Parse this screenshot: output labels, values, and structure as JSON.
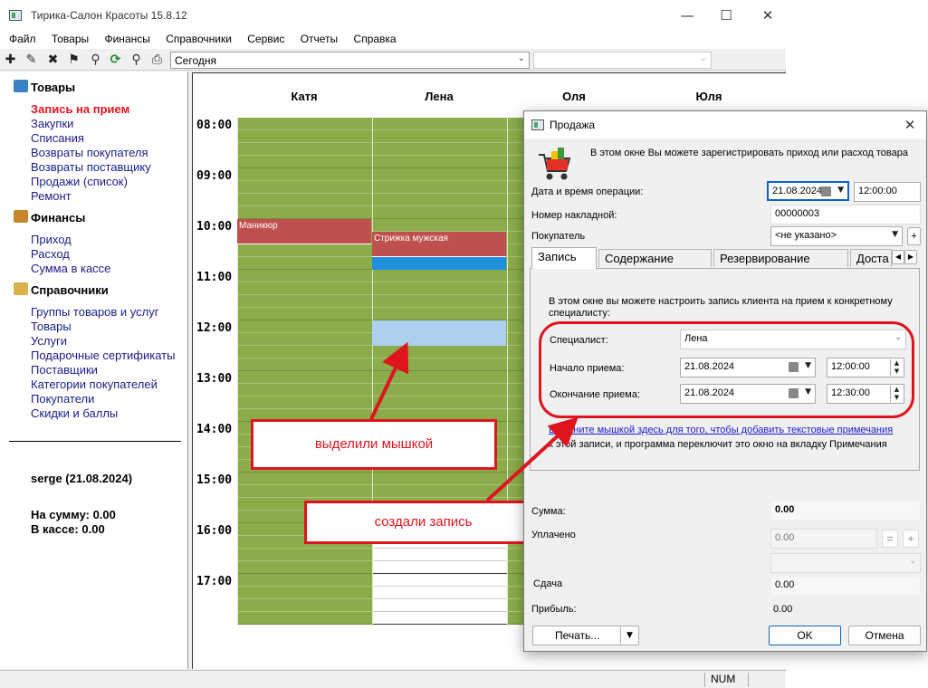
{
  "window": {
    "title": "Тирика-Салон Красоты 15.8.12",
    "minimize_icon": "minimize-icon",
    "maximize_icon": "maximize-icon",
    "close_icon": "close-icon"
  },
  "menu": [
    "Файл",
    "Товары",
    "Финансы",
    "Справочники",
    "Сервис",
    "Отчеты",
    "Справка"
  ],
  "toolbar": {
    "icons": [
      "plus-icon",
      "pencil-icon",
      "delete-icon",
      "flag-icon",
      "pin-icon",
      "refresh-icon",
      "magnifier-icon",
      "printer-icon"
    ],
    "period_value": "Сегодня",
    "second_combo_value": ""
  },
  "sidebar": {
    "sections": [
      {
        "title": "Товары",
        "icon": "box-icon",
        "items": [
          "Запись на прием",
          "Закупки",
          "Списания",
          "Возвраты покупателя",
          "Возвраты поставщику",
          "Продажи (список)",
          "Ремонт"
        ]
      },
      {
        "title": "Финансы",
        "icon": "wallet-icon",
        "items": [
          "Приход",
          "Расход",
          "Сумма в кассе"
        ]
      },
      {
        "title": "Справочники",
        "icon": "folder-icon",
        "items": [
          "Группы товаров и услуг",
          "Товары",
          "Услуги",
          "Подарочные сертификаты",
          "Поставщики",
          "Категории покупателей",
          "Покупатели",
          "Скидки и баллы"
        ]
      }
    ],
    "active_item": "Запись на прием",
    "user_line": "serge (21.08.2024)",
    "sum_line": "На сумму: 0.00",
    "cash_line": "В кассе: 0.00"
  },
  "schedule": {
    "specialists": [
      "Катя",
      "Лена",
      "Оля",
      "Юля"
    ],
    "hours": [
      "08:00",
      "09:00",
      "10:00",
      "11:00",
      "12:00",
      "13:00",
      "14:00",
      "15:00",
      "16:00",
      "17:00"
    ],
    "appointments": [
      {
        "specialist": "Катя",
        "label": "Маникюр",
        "start": "10:00",
        "end": "10:30"
      },
      {
        "specialist": "Лена",
        "label": "Стрижка мужская",
        "start": "10:15",
        "end": "10:45"
      }
    ],
    "selection": {
      "specialist": "Лена",
      "start": "12:00",
      "end": "12:30"
    },
    "colors": {
      "working": "#8aac4a",
      "free": "#ffffff",
      "appointment": "#c0504d",
      "current": "#1e90dc",
      "selection": "#aed0f0",
      "annotation": "#e0141e"
    }
  },
  "statusbar": {
    "num": "NUM"
  },
  "annotations": {
    "selected": "выделили мышкой",
    "created": "создали запись"
  },
  "dialog": {
    "title": "Продажа",
    "icon": "shopping-cart-icon",
    "intro": "В этом окне Вы можете зарегистрировать приход или расход товара",
    "datetime_label": "Дата и время операции:",
    "date_value": "21.08.2024",
    "time_value": "12:00:00",
    "invoice_label": "Номер накладной:",
    "invoice_value": "00000003",
    "buyer_label": "Покупатель",
    "buyer_value": "<не указано>",
    "buyer_add": "+",
    "tabs": [
      "Запись",
      "Содержание",
      "Резервирование",
      "Доста"
    ],
    "tab_page": {
      "description": "В этом окне вы можете настроить запись клиента на прием к конкретному специалисту:",
      "specialist_label": "Специалист:",
      "specialist_value": "Лена",
      "start_label": "Начало приема:",
      "start_date": "21.08.2024",
      "start_time": "12:00:00",
      "end_label": "Окончание приема:",
      "end_date": "21.08.2024",
      "end_time": "12:30:00",
      "note_link": "Щелкните мышкой здесь для того, чтобы добавить текстовые примечания",
      "note_rest": "к этой записи, и программа переключит это окно на вкладку Примечания"
    },
    "sum_label": "Сумма:",
    "sum_value": "0.00",
    "paid_label": "Уплачено",
    "paid_value": "0.00",
    "equals_btn": "=",
    "plus_btn": "+",
    "change_label": "Сдача",
    "change_value": "0.00",
    "profit_label": "Прибыль:",
    "profit_value": "0.00",
    "print_btn": "Печать...",
    "ok_btn": "OK",
    "cancel_btn": "Отмена"
  }
}
